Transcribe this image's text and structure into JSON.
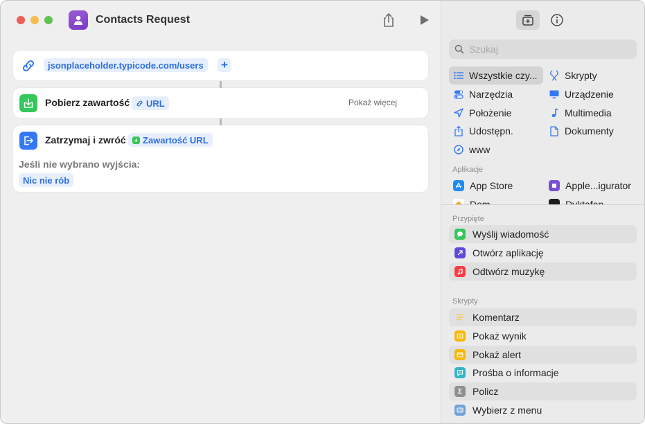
{
  "window": {
    "title": "Contacts Request"
  },
  "workflow": {
    "url_action": {
      "url": "jsonplaceholder.typicode.com/users",
      "add_symbol": "+"
    },
    "get_contents": {
      "label": "Pobierz zawartość",
      "param": "URL",
      "show_more": "Pokaż więcej"
    },
    "stop_return": {
      "label": "Zatrzymaj i zwróć",
      "param": "Zawartość URL",
      "no_output_label": "Jeśli nie wybrano wyjścia:",
      "no_output_value": "Nic nie rób"
    }
  },
  "library": {
    "search_placeholder": "Szukaj",
    "categories": [
      {
        "label": "Wszystkie czy...",
        "icon": "list-icon",
        "selected": true
      },
      {
        "label": "Skrypty",
        "icon": "script-icon"
      },
      {
        "label": "Narzędzia",
        "icon": "toggles-icon"
      },
      {
        "label": "Urządzenie",
        "icon": "display-icon"
      },
      {
        "label": "Położenie",
        "icon": "location-arrow-icon"
      },
      {
        "label": "Multimedia",
        "icon": "music-note-icon"
      },
      {
        "label": "Udostępn.",
        "icon": "share-icon"
      },
      {
        "label": "Dokumenty",
        "icon": "document-icon"
      },
      {
        "label": "www",
        "icon": "compass-icon"
      }
    ],
    "apps_section": "Aplikacje",
    "apps": [
      {
        "label": "App Store",
        "color": "#1f8cf6"
      },
      {
        "label": "Apple...igurator",
        "color": "#7a4fd6"
      },
      {
        "label": "Dom",
        "color": "#f5a623"
      },
      {
        "label": "Dyktafon",
        "color": "#1c1c1e"
      }
    ],
    "pinned_section": "Przypięte",
    "pinned": [
      {
        "label": "Wyślij wiadomość",
        "color": "#34c759"
      },
      {
        "label": "Otwórz aplikację",
        "color": "#5e4bd8"
      },
      {
        "label": "Odtwórz muzykę",
        "color": "#fc3c44"
      }
    ],
    "scripts_section": "Skrypty",
    "scripts": [
      {
        "label": "Komentarz",
        "color": "#f4c430"
      },
      {
        "label": "Pokaż wynik",
        "color": "#f6b800"
      },
      {
        "label": "Pokaż alert",
        "color": "#f6b800"
      },
      {
        "label": "Prośba o informacje",
        "color": "#32b7c9"
      },
      {
        "label": "Policz",
        "color": "#8e8e93"
      },
      {
        "label": "Wybierz z menu",
        "color": "#6ea3d8"
      }
    ]
  }
}
